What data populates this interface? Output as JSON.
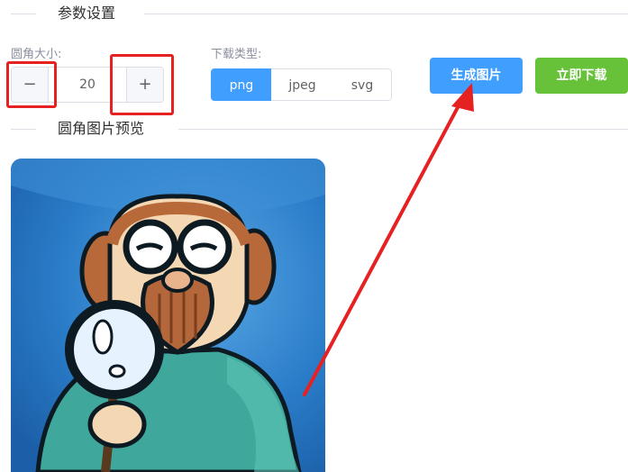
{
  "section_settings": {
    "title": "参数设置"
  },
  "radius": {
    "label": "圆角大小:",
    "value": "20",
    "minus_symbol": "−",
    "plus_symbol": "+"
  },
  "download_type": {
    "label": "下载类型:",
    "options": [
      "png",
      "jpeg",
      "svg"
    ],
    "selected": "png"
  },
  "buttons": {
    "generate": "生成图片",
    "download": "立即下载"
  },
  "section_preview": {
    "title": "圆角图片预览"
  },
  "colors": {
    "primary": "#409eff",
    "success": "#67c23a",
    "annotation": "#e52121"
  }
}
